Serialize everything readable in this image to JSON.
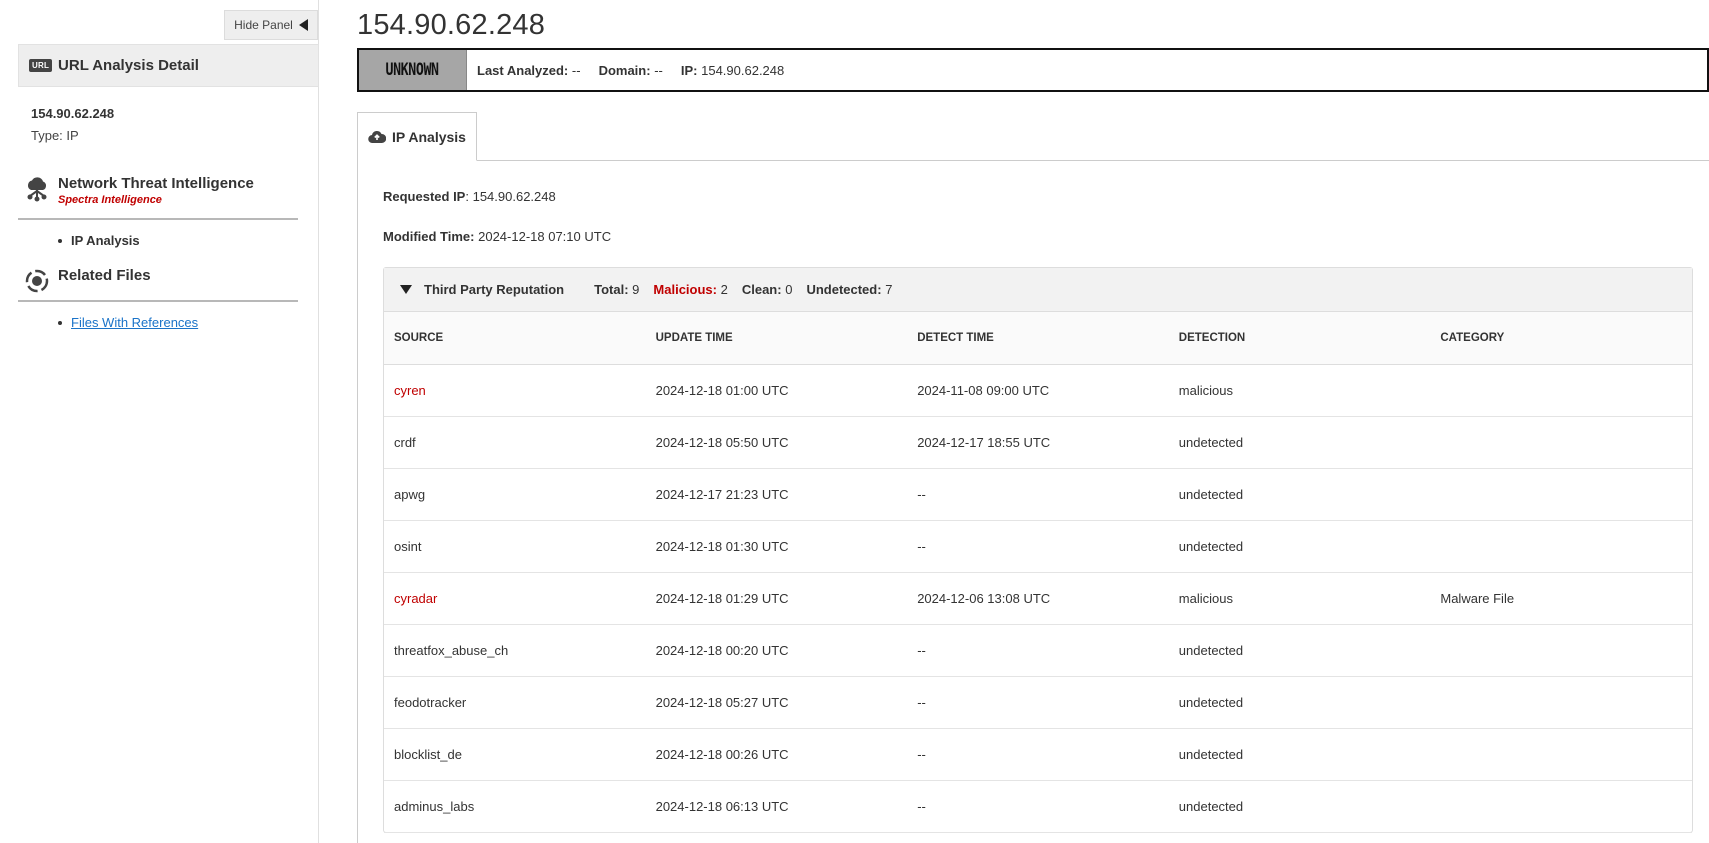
{
  "panel": {
    "hide_label": "Hide Panel",
    "detail_icon": "URL",
    "detail_title": "URL Analysis Detail",
    "item_name": "154.90.62.248",
    "item_type": "Type: IP",
    "sections": [
      {
        "title": "Network Threat Intelligence",
        "subtitle": "Spectra Intelligence",
        "icon": "cloud-network-icon",
        "links": [
          {
            "label": "IP Analysis"
          }
        ]
      },
      {
        "title": "Related Files",
        "icon": "target-icon",
        "links": [
          {
            "label": "Files With References"
          }
        ]
      }
    ]
  },
  "main": {
    "title": "154.90.62.248",
    "verdict": "UNKNOWN",
    "last_analyzed_label": "Last Analyzed:",
    "last_analyzed_value": "--",
    "domain_label": "Domain:",
    "domain_value": "--",
    "ip_label": "IP:",
    "ip_value": "154.90.62.248",
    "tab_label": "IP Analysis",
    "requested_ip_label": "Requested IP",
    "requested_ip_value": "154.90.62.248",
    "modified_time_label": "Modified Time:",
    "modified_time_value": "2024-12-18 07:10 UTC"
  },
  "reputation": {
    "title": "Third Party Reputation",
    "total_label": "Total:",
    "total_value": "9",
    "malicious_label": "Malicious:",
    "malicious_value": "2",
    "clean_label": "Clean:",
    "clean_value": "0",
    "undetected_label": "Undetected:",
    "undetected_value": "7",
    "columns": [
      "SOURCE",
      "UPDATE TIME",
      "DETECT TIME",
      "DETECTION",
      "CATEGORY"
    ],
    "rows": [
      {
        "source": "cyren",
        "update": "2024-12-18 01:00 UTC",
        "detect": "2024-11-08 09:00 UTC",
        "detection": "malicious",
        "category": ""
      },
      {
        "source": "crdf",
        "update": "2024-12-18 05:50 UTC",
        "detect": "2024-12-17 18:55 UTC",
        "detection": "undetected",
        "category": ""
      },
      {
        "source": "apwg",
        "update": "2024-12-17 21:23 UTC",
        "detect": "--",
        "detection": "undetected",
        "category": ""
      },
      {
        "source": "osint",
        "update": "2024-12-18 01:30 UTC",
        "detect": "--",
        "detection": "undetected",
        "category": ""
      },
      {
        "source": "cyradar",
        "update": "2024-12-18 01:29 UTC",
        "detect": "2024-12-06 13:08 UTC",
        "detection": "malicious",
        "category": "Malware File"
      },
      {
        "source": "threatfox_abuse_ch",
        "update": "2024-12-18 00:20 UTC",
        "detect": "--",
        "detection": "undetected",
        "category": ""
      },
      {
        "source": "feodotracker",
        "update": "2024-12-18 05:27 UTC",
        "detect": "--",
        "detection": "undetected",
        "category": ""
      },
      {
        "source": "blocklist_de",
        "update": "2024-12-18 00:26 UTC",
        "detect": "--",
        "detection": "undetected",
        "category": ""
      },
      {
        "source": "adminus_labs",
        "update": "2024-12-18 06:13 UTC",
        "detect": "--",
        "detection": "undetected",
        "category": ""
      }
    ]
  },
  "colors": {
    "malicious": "#c00000",
    "link": "#1a73c8",
    "verdict_bg": "#a6a6a6"
  }
}
